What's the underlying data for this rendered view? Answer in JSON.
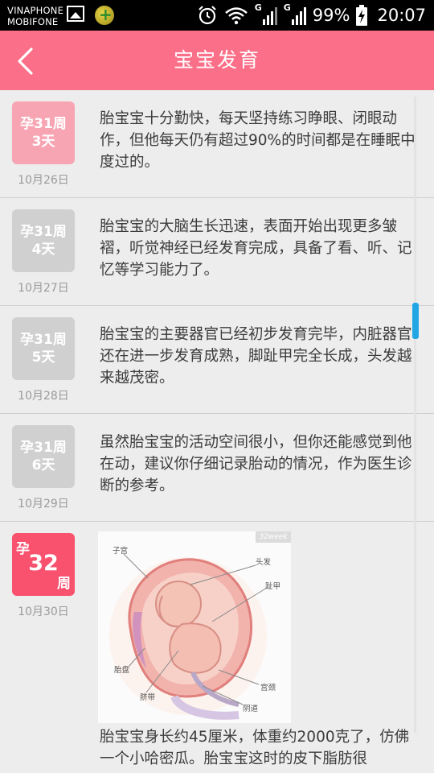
{
  "status_bar": {
    "carrier_1": "VINAPHONE",
    "carrier_2": "MOBIFONE",
    "network_1": "G",
    "network_2": "G",
    "battery": "99%",
    "time": "20:07"
  },
  "header": {
    "title": "宝宝发育",
    "back_icon": "chevron-left-icon",
    "color": "#fb6f88"
  },
  "timeline": {
    "days": [
      {
        "week": "孕31周",
        "day": "3天",
        "date": "10月26日",
        "active": true,
        "text": "胎宝宝十分勤快，每天坚持练习睁眼、闭眼动作，但他每天仍有超过90%的时间都是在睡眠中度过的。"
      },
      {
        "week": "孕31周",
        "day": "4天",
        "date": "10月27日",
        "active": false,
        "text": "胎宝宝的大脑生长迅速，表面开始出现更多皱褶，听觉神经已经发育完成，具备了看、听、记忆等学习能力了。"
      },
      {
        "week": "孕31周",
        "day": "5天",
        "date": "10月28日",
        "active": false,
        "text": "胎宝宝的主要器官已经初步发育完毕，内脏器官还在进一步发育成熟，脚趾甲完全长成，头发越来越茂密。"
      },
      {
        "week": "孕31周",
        "day": "6天",
        "date": "10月29日",
        "active": false,
        "text": "虽然胎宝宝的活动空间很小，但你还能感觉到他在动，建议你仔细记录胎动的情况，作为医生诊断的参考。"
      }
    ],
    "week_entry": {
      "prefix": "孕",
      "number": "32",
      "suffix": "周",
      "date": "10月30日",
      "image_tag": "32week",
      "labels": {
        "uterus": "子宫",
        "hair": "头发",
        "toenail": "趾甲",
        "placenta": "胎盘",
        "cervix": "宫颈",
        "umbilical_cord": "脐带",
        "vagina": "阴道"
      },
      "text": "胎宝宝身长约45厘米，体重约2000克了，仿佛一个小哈密瓜。胎宝宝这时的皮下脂肪很"
    }
  },
  "colors": {
    "active_day_badge": "#f8a5b3",
    "inactive_day_badge": "#d0d0d0",
    "week_badge": "#f9526f",
    "scroll_thumb": "#22a6e4"
  }
}
